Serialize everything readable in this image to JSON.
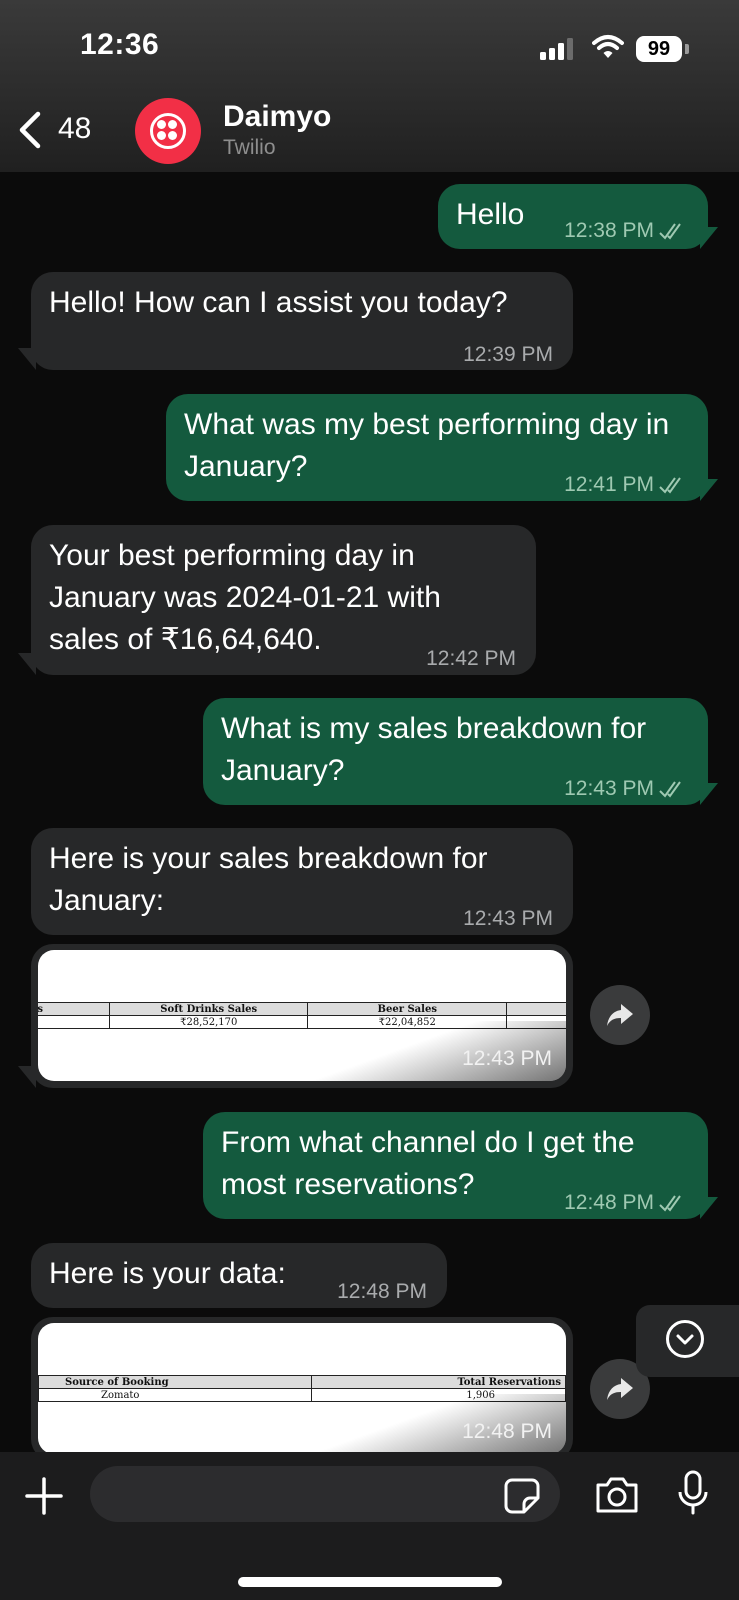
{
  "status_bar": {
    "time": "12:36",
    "battery": "99"
  },
  "header": {
    "back_count": "48",
    "contact_name": "Daimyo",
    "contact_subtitle": "Twilio"
  },
  "messages": [
    {
      "direction": "out",
      "text": "Hello",
      "time": "12:38 PM"
    },
    {
      "direction": "in",
      "text": "Hello! How can I assist you today?",
      "time": "12:39 PM"
    },
    {
      "direction": "out",
      "text": "What was my best performing day in January?",
      "time": "12:41 PM"
    },
    {
      "direction": "in",
      "text": "Your best performing day in January was 2024-01-21 with sales of ₹16,64,640.",
      "time": "12:42 PM"
    },
    {
      "direction": "out",
      "text": "What is my sales breakdown for January?",
      "time": "12:43 PM"
    },
    {
      "direction": "in",
      "text": "Here is your sales breakdown for January:",
      "time": "12:43 PM"
    },
    {
      "direction": "in",
      "type": "image",
      "time": "12:43 PM",
      "table": {
        "headers": [
          "es",
          "Soft Drinks Sales",
          "Beer Sales",
          "W"
        ],
        "row": [
          "",
          "₹28,52,170",
          "₹22,04,852",
          ""
        ]
      }
    },
    {
      "direction": "out",
      "text": "From what channel do I get the most reservations?",
      "time": "12:48 PM"
    },
    {
      "direction": "in",
      "text": "Here is your data:",
      "time": "12:48 PM"
    },
    {
      "direction": "in",
      "type": "image",
      "time": "12:48 PM",
      "table": {
        "headers": [
          "Source of Booking",
          "Total Reservations"
        ],
        "row": [
          "Zomato",
          "1,906"
        ]
      }
    }
  ],
  "icons": [
    "back-chevron-icon",
    "twilio-logo-icon",
    "read-receipt-icon",
    "forward-icon",
    "scroll-down-icon",
    "plus-icon",
    "sticker-icon",
    "camera-icon",
    "microphone-icon"
  ],
  "colors": {
    "incoming_bubble": "#272829",
    "outgoing_bubble": "#145a3e",
    "background": "#0b0b0b",
    "avatar": "#f22f46"
  }
}
